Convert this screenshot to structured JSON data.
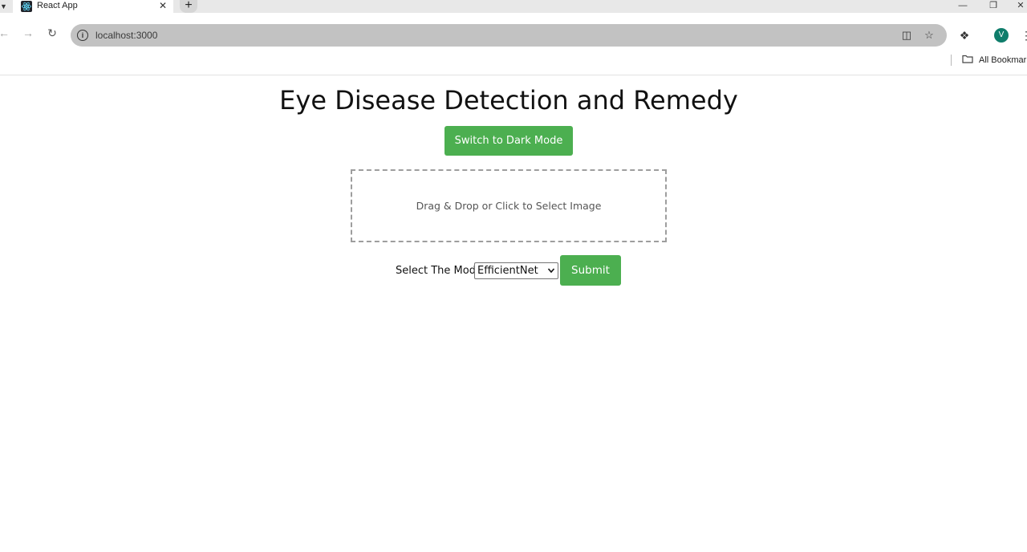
{
  "browser": {
    "tab_title": "React App",
    "url": "localhost:3000",
    "profile_initial": "V",
    "bookmarks_label": "All Bookmarks"
  },
  "page": {
    "title": "Eye Disease Detection and Remedy",
    "dark_mode_button": "Switch to Dark Mode",
    "dropzone_text": "Drag & Drop or Click to Select Image",
    "model_label": "Select The Model",
    "model_selected": "EfficientNet",
    "submit_button": "Submit"
  },
  "colors": {
    "accent_green": "#4caf50",
    "avatar": "#0f7d6b"
  }
}
